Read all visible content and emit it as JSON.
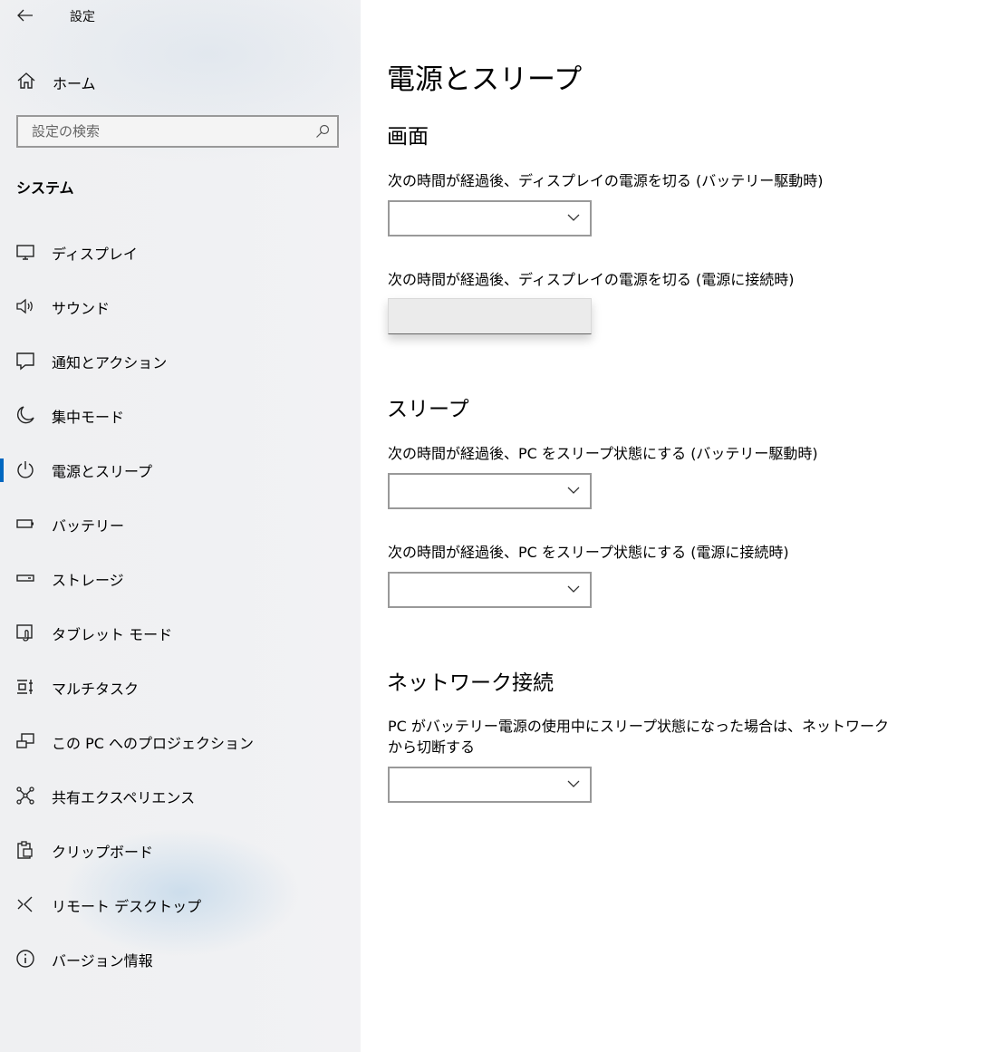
{
  "window": {
    "title": "設定"
  },
  "sidebar": {
    "home_label": "ホーム",
    "search_placeholder": "設定の検索",
    "section_label": "システム",
    "items": [
      {
        "label": "ディスプレイ",
        "icon": "display-icon"
      },
      {
        "label": "サウンド",
        "icon": "speaker-icon"
      },
      {
        "label": "通知とアクション",
        "icon": "notification-icon"
      },
      {
        "label": "集中モード",
        "icon": "moon-icon"
      },
      {
        "label": "電源とスリープ",
        "icon": "power-icon",
        "active": true
      },
      {
        "label": "バッテリー",
        "icon": "battery-icon"
      },
      {
        "label": "ストレージ",
        "icon": "storage-icon"
      },
      {
        "label": "タブレット モード",
        "icon": "tablet-icon"
      },
      {
        "label": "マルチタスク",
        "icon": "multitask-icon"
      },
      {
        "label": "この PC へのプロジェクション",
        "icon": "projection-icon"
      },
      {
        "label": "共有エクスペリエンス",
        "icon": "share-icon"
      },
      {
        "label": "クリップボード",
        "icon": "clipboard-icon"
      },
      {
        "label": "リモート デスクトップ",
        "icon": "remote-desktop-icon"
      },
      {
        "label": "バージョン情報",
        "icon": "info-icon"
      }
    ]
  },
  "main": {
    "title": "電源とスリープ",
    "screen": {
      "heading": "画面",
      "battery_label": "次の時間が経過後、ディスプレイの電源を切る (バッテリー駆動時)",
      "battery_value": "",
      "plugged_label": "次の時間が経過後、ディスプレイの電源を切る (電源に接続時)",
      "plugged_value": ""
    },
    "sleep": {
      "heading": "スリープ",
      "battery_label": "次の時間が経過後、PC をスリープ状態にする (バッテリー駆動時)",
      "battery_value": "",
      "plugged_label": "次の時間が経過後、PC をスリープ状態にする (電源に接続時)",
      "plugged_value": ""
    },
    "network": {
      "heading": "ネットワーク接続",
      "label": "PC がバッテリー電源の使用中にスリープ状態になった場合は、ネットワークから切断する",
      "value": ""
    }
  },
  "colors": {
    "accent": "#0067c0",
    "border": "#999999"
  }
}
